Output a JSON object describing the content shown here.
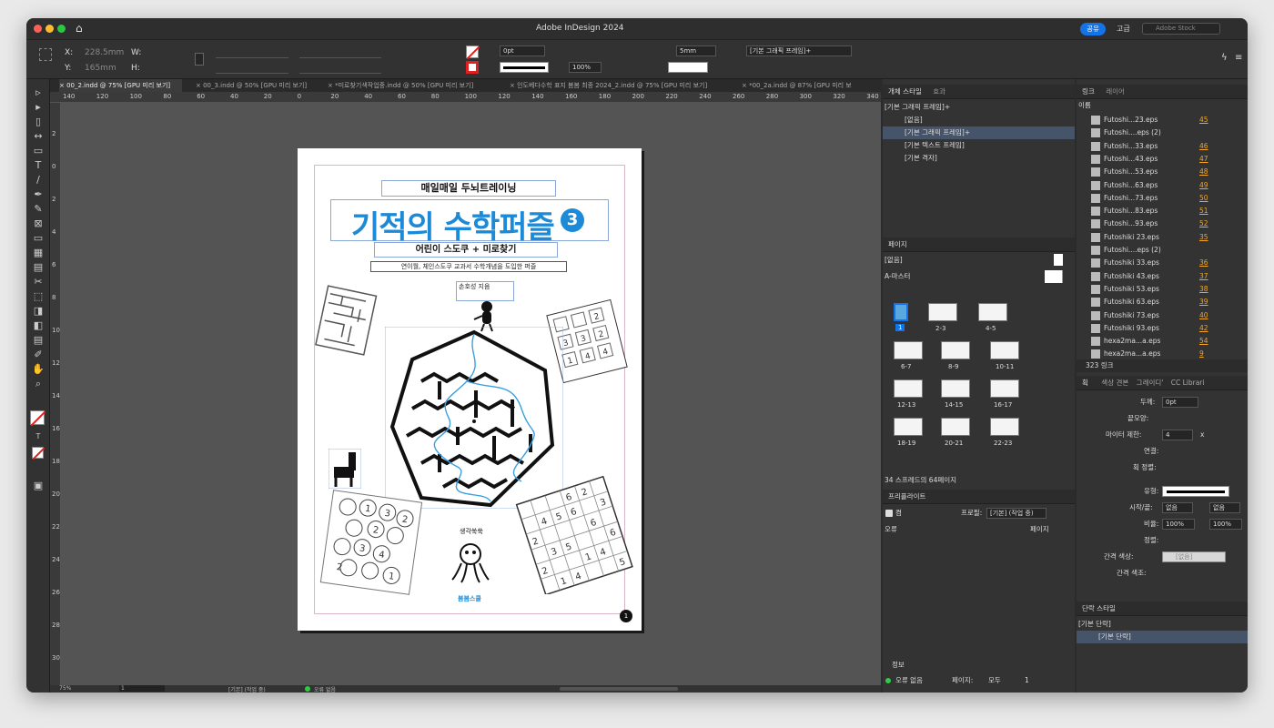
{
  "window": {
    "title": "Adobe InDesign 2024"
  },
  "topbar": {
    "share": "공유",
    "advanced": "고급",
    "stock_placeholder": "Adobe Stock"
  },
  "control": {
    "x_label": "X:",
    "x_value": "228.5mm",
    "y_label": "Y:",
    "y_value": "165mm",
    "w_label": "W:",
    "h_label": "H:",
    "stroke_weight": "0pt",
    "opacity": "100%",
    "size_value": "5mm",
    "object_style": "[기본 그래픽 프레임]+"
  },
  "tabs": [
    "× 00_2.indd @ 75% [GPU 미리 보기]",
    "× 00_3.indd @ 50% [GPU 미리 보기]",
    "× *미로찾기색작업중.indd @ 50% [GPU 미리 보기]",
    "× 인도베다수학 표지 봄봄 최종 2024_2.indd @ 75% [GPU 미리 보기]",
    "× *00_2a.indd @ 87% [GPU 미리 보"
  ],
  "ruler_h": [
    "140",
    "120",
    "100",
    "80",
    "60",
    "40",
    "20",
    "0",
    "20",
    "40",
    "60",
    "80",
    "100",
    "120",
    "140",
    "160",
    "180",
    "200",
    "220",
    "240",
    "260",
    "280",
    "300",
    "320",
    "340"
  ],
  "ruler_v": [
    "2",
    "0",
    "2",
    "4",
    "6",
    "8",
    "10",
    "12",
    "14",
    "16",
    "18",
    "20",
    "22",
    "24",
    "26",
    "28",
    "30"
  ],
  "cover": {
    "top": "매일매일 두뇌트레이닝",
    "title": "기적의 수학퍼즐",
    "title_num": "3",
    "subtitle": "어린이 스도쿠 + 미로찾기",
    "caption": "연이월, 체인스도쿠 교과서 수학개념을 도입한 퍼즐",
    "author": "손호성 지음",
    "publisher": "봄봄스쿨",
    "speech": "생각쑥쑥",
    "page_number": "1",
    "sudoku_small": [
      "2",
      "3",
      "2",
      "3",
      "4",
      "1",
      "4"
    ],
    "circles": [
      "1",
      "3",
      "2",
      "2",
      "3",
      "4",
      "2",
      "1"
    ],
    "sudoku_big": [
      "2",
      "3",
      "4",
      "5",
      "6",
      "6",
      "2",
      "3",
      "5",
      "6",
      "1",
      "4",
      "2",
      "1",
      "4",
      "6",
      "5"
    ]
  },
  "status": {
    "zoom": "75%",
    "page": "1",
    "workflow": "[기본] (작업 중)",
    "errors": "오류 없음"
  },
  "object_styles": {
    "tab1": "개체 스타일",
    "tab2": "효과",
    "current": "[기본 그래픽 프레임]+",
    "items": [
      "[없음]",
      "[기본 그래픽 프레임]+",
      "[기본 텍스트 프레임]",
      "[기본 격자]"
    ]
  },
  "pages": {
    "tab": "페이지",
    "none": "[없음]",
    "master": "A-마스터",
    "spreads": [
      "1",
      "2-3",
      "4-5",
      "6-7",
      "8-9",
      "10-11",
      "12-13",
      "14-15",
      "16-17",
      "18-19",
      "20-21",
      "22-23"
    ],
    "footer": "34 스프레드의 64페이지"
  },
  "preflight": {
    "tab": "프리플라이트",
    "on": "켬",
    "profile_label": "프로필:",
    "profile": "[기본] (작업 중)",
    "col_error": "오류",
    "col_page": "페이지",
    "info": "정보",
    "status": "오류 없음",
    "pages_label": "페이지:",
    "all": "모두",
    "one": "1"
  },
  "links": {
    "tab1": "링크",
    "tab2": "레이어",
    "col_name": "이름",
    "items": [
      {
        "name": "Futoshi...23.eps",
        "page": "45"
      },
      {
        "name": "Futoshi....eps (2)",
        "page": ""
      },
      {
        "name": "Futoshi...33.eps",
        "page": "46"
      },
      {
        "name": "Futoshi...43.eps",
        "page": "47"
      },
      {
        "name": "Futoshi...53.eps",
        "page": "48"
      },
      {
        "name": "Futoshi...63.eps",
        "page": "49"
      },
      {
        "name": "Futoshi...73.eps",
        "page": "50"
      },
      {
        "name": "Futoshi...83.eps",
        "page": "51"
      },
      {
        "name": "Futoshi...93.eps",
        "page": "52"
      },
      {
        "name": "Futoshiki 23.eps",
        "page": "35"
      },
      {
        "name": "Futoshi....eps (2)",
        "page": ""
      },
      {
        "name": "Futoshiki 33.eps",
        "page": "36"
      },
      {
        "name": "Futoshiki 43.eps",
        "page": "37"
      },
      {
        "name": "Futoshiki 53.eps",
        "page": "38"
      },
      {
        "name": "Futoshiki 63.eps",
        "page": "39"
      },
      {
        "name": "Futoshiki 73.eps",
        "page": "40"
      },
      {
        "name": "Futoshiki 93.eps",
        "page": "42"
      },
      {
        "name": "hexa2ma...a.eps",
        "page": "54"
      },
      {
        "name": "hexa2ma...a.eps",
        "page": "9"
      }
    ],
    "count": "323 링크"
  },
  "stroke": {
    "tabs": [
      "획",
      "색상 견본",
      "그레이디'",
      "CC Librari"
    ],
    "weight_label": "두께:",
    "weight": "0pt",
    "cap_label": "끝모양:",
    "miter_label": "마이터 제한:",
    "miter": "4",
    "miter_x": "x",
    "join_label": "연결:",
    "align_label": "획 정렬:",
    "type_label": "유형:",
    "startend_label": "시작/끝:",
    "start": "없음",
    "end": "없음",
    "scale_label": "비율:",
    "scale1": "100%",
    "scale2": "100%",
    "align2_label": "정렬:",
    "gapcolor_label": "간격 색상:",
    "gapcolor": "[없음]",
    "gaptint_label": "간격 색조:"
  },
  "para_styles": {
    "tab": "단락 스타일",
    "current": "[기본 단락]",
    "item": "[기본 단락]"
  },
  "colors": {
    "accent": "#1d8ad8",
    "share": "#1473e6",
    "link_page": "#f5a623",
    "selected": "#46546a"
  }
}
